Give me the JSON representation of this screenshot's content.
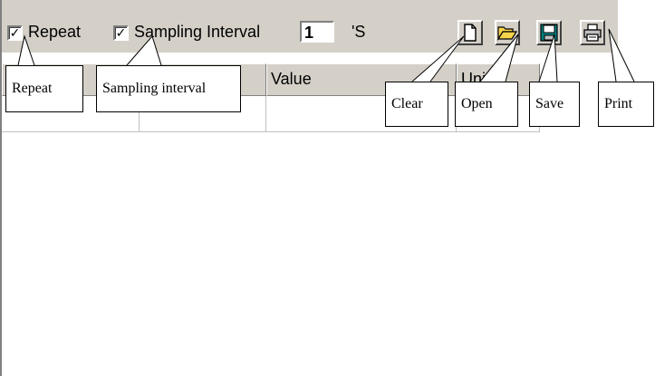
{
  "toolbar": {
    "repeat_checked": "✓",
    "repeat_label": "Repeat",
    "sampling_checked": "✓",
    "sampling_label": "Sampling Interval",
    "interval_value": "1",
    "interval_unit": "'S",
    "buttons": {
      "clear_icon": "new-document-icon",
      "open_icon": "folder-open-icon",
      "save_icon": "floppy-disk-icon",
      "print_icon": "printer-icon"
    }
  },
  "table": {
    "columns": [
      "",
      "",
      "Value",
      "Unit"
    ]
  },
  "callouts": {
    "repeat": "Repeat",
    "sampling": "Sampling interval",
    "clear": "Clear",
    "open": "Open",
    "save": "Save",
    "print": "Print"
  },
  "colors": {
    "face": "#d4d0c8",
    "folder": "#f7d44c",
    "disk": "#008080"
  }
}
